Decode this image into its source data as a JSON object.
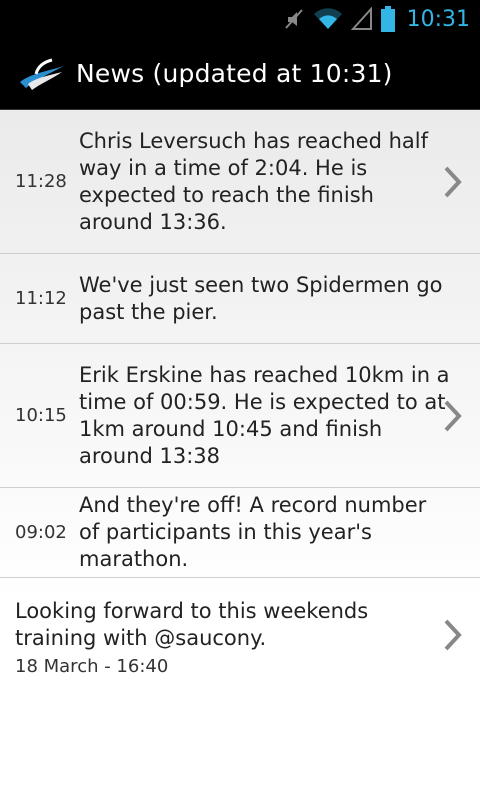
{
  "status_bar": {
    "time": "10:31",
    "icons": [
      "mute-icon",
      "wifi-icon",
      "signal-icon",
      "battery-icon"
    ],
    "accent_color": "#33b5e5"
  },
  "action_bar": {
    "title": "News (updated at 10:31)",
    "logo": "app-logo-icon"
  },
  "news": [
    {
      "time": "11:28",
      "text": "Chris Leversuch has reached half way in a time of 2:04. He is expected to reach the finish around 13:36.",
      "has_detail": true
    },
    {
      "time": "11:12",
      "text": "We've just seen two Spidermen go past the pier.",
      "has_detail": false
    },
    {
      "time": "10:15",
      "text": "Erik Erskine has reached 10km in a time of 00:59. He is expected to at 1km around 10:45 and finish around 13:38",
      "has_detail": true
    },
    {
      "time": "09:02",
      "text": "And they're off! A record number of participants in this year's marathon.",
      "has_detail": false
    }
  ],
  "tweet": {
    "text": "Looking forward to this weekends training with @saucony.",
    "date": "18 March - 16:40",
    "has_detail": true
  }
}
